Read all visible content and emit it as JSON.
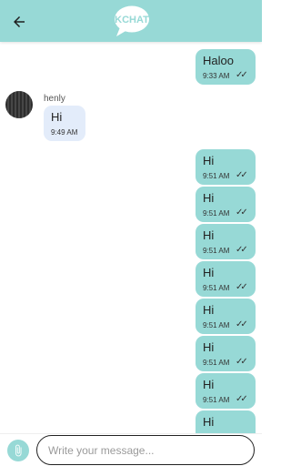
{
  "app": {
    "logo_text": "KCHAT",
    "accent_color": "#97d9d6",
    "incoming_bubble_color": "#e3ecfa"
  },
  "messages": {
    "first": {
      "text": "Haloo",
      "time": "9:33 AM",
      "status": "✓✓"
    },
    "incoming": {
      "sender": "henly",
      "text": "Hi",
      "time": "9:49 AM"
    },
    "sent": [
      {
        "text": "Hi",
        "time": "9:51 AM",
        "status": "✓✓"
      },
      {
        "text": "Hi",
        "time": "9:51 AM",
        "status": "✓✓"
      },
      {
        "text": "Hi",
        "time": "9:51 AM",
        "status": "✓✓"
      },
      {
        "text": "Hi",
        "time": "9:51 AM",
        "status": "✓✓"
      },
      {
        "text": "Hi",
        "time": "9:51 AM",
        "status": "✓✓"
      },
      {
        "text": "Hi",
        "time": "9:51 AM",
        "status": "✓✓"
      },
      {
        "text": "Hi",
        "time": "9:51 AM",
        "status": "✓✓"
      },
      {
        "text": "Hi"
      }
    ]
  },
  "composer": {
    "placeholder": "Write your message..."
  }
}
